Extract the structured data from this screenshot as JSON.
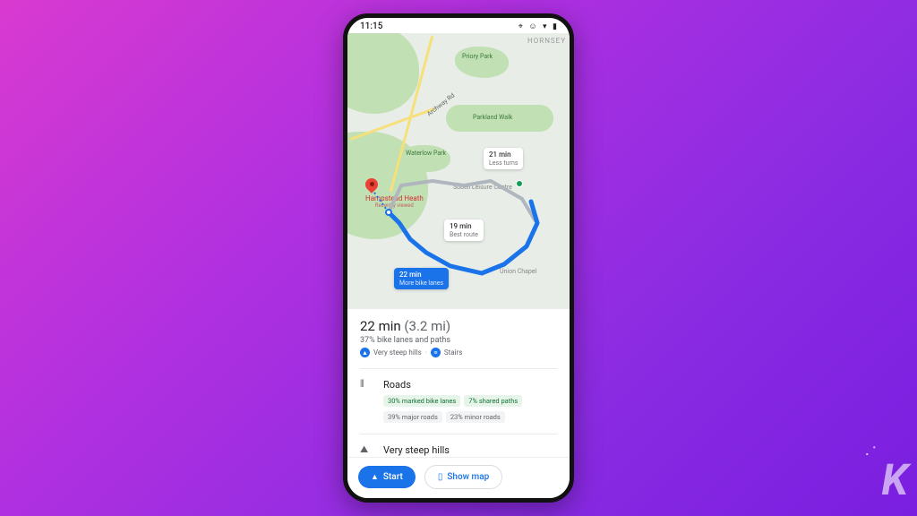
{
  "statusbar": {
    "time": "11:15"
  },
  "map": {
    "corner_label": "HORNSEY",
    "parks": {
      "priory": "Priory Park",
      "parkland": "Parkland Walk",
      "waterlow": "Waterlow Park"
    },
    "roads": {
      "archway": "Archway Rd"
    },
    "destination": {
      "name": "Hampstead Heath",
      "sub": "Recently viewed"
    },
    "poi": {
      "sobell": "Sobell Leisure Centre",
      "union": "Union Chapel"
    },
    "callouts": {
      "alt1": {
        "time": "21 min",
        "sub": "Less turns"
      },
      "best": {
        "time": "19 min",
        "sub": "Best route"
      },
      "active": {
        "time": "22 min",
        "sub": "More bike lanes"
      }
    }
  },
  "summary": {
    "duration": "22 min",
    "distance": "(3.2 mi)",
    "sub": "37% bike lanes and paths",
    "warn1": "Very steep hills",
    "warn2": "Stairs"
  },
  "roads_section": {
    "title": "Roads",
    "chips": {
      "a": "30% marked bike lanes",
      "b": "7% shared paths",
      "c": "39% major roads",
      "d": "23% minor roads"
    }
  },
  "steep_section": {
    "title": "Very steep hills"
  },
  "actions": {
    "start": "Start",
    "showmap": "Show map"
  },
  "watermark": "K"
}
